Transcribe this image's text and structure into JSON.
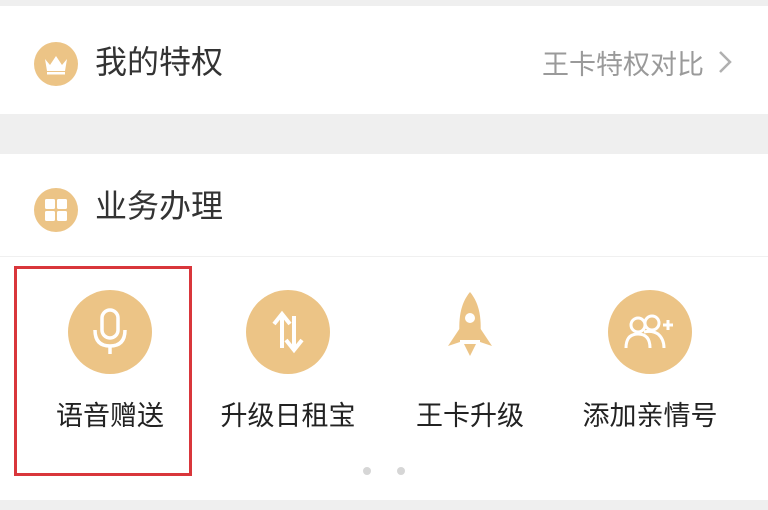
{
  "privilege": {
    "title": "我的特权",
    "icon": "crown-icon",
    "compare_link": "王卡特权对比",
    "chevron_icon": "chevron-right-icon"
  },
  "services": {
    "title": "业务办理",
    "icon": "grid-icon",
    "items": [
      {
        "label": "语音赠送",
        "icon": "microphone-icon",
        "selected": true
      },
      {
        "label": "升级日租宝",
        "icon": "up-down-arrows-icon"
      },
      {
        "label": "王卡升级",
        "icon": "rocket-icon"
      },
      {
        "label": "添加亲情号",
        "icon": "add-family-icon"
      }
    ],
    "pager_pages": 2
  },
  "colors": {
    "accent": "#ecc486",
    "highlight": "#d9363b",
    "text": "#333333",
    "muted": "#9a9a9a"
  }
}
